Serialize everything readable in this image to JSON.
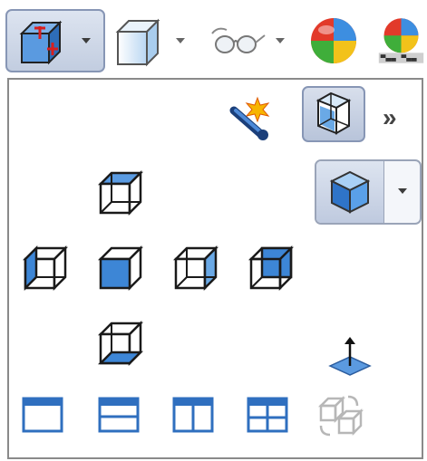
{
  "toolbar": {
    "buttons": [
      {
        "id": "view-orientation",
        "icon": "view-orientation-icon",
        "has_dropdown": true,
        "active": true
      },
      {
        "id": "display-style",
        "icon": "display-style-icon",
        "has_dropdown": true
      },
      {
        "id": "hide-show-items",
        "icon": "glasses-icon",
        "has_dropdown": true
      },
      {
        "id": "edit-appearance",
        "icon": "appearance-sphere-icon",
        "has_dropdown": false
      },
      {
        "id": "apply-scene",
        "icon": "scene-icon",
        "has_dropdown": false
      }
    ],
    "more_label": "»"
  },
  "panel": {
    "top_row": [
      {
        "id": "new-view",
        "icon": "new-view-wand-icon"
      },
      {
        "id": "view-selector",
        "icon": "view-selector-cube-icon",
        "active": true
      },
      {
        "id": "more",
        "icon": "chevron-double-right-icon"
      }
    ],
    "view_buttons": [
      {
        "id": "top",
        "icon": "top-view-icon"
      },
      {
        "id": "isometric",
        "icon": "isometric-view-icon"
      },
      {
        "id": "left",
        "icon": "left-view-icon"
      },
      {
        "id": "front",
        "icon": "front-view-icon"
      },
      {
        "id": "right",
        "icon": "right-view-icon"
      },
      {
        "id": "back",
        "icon": "back-view-icon"
      },
      {
        "id": "bottom",
        "icon": "bottom-view-icon"
      },
      {
        "id": "normal-to",
        "icon": "normal-to-icon"
      }
    ],
    "viewport_buttons": [
      {
        "id": "single-view",
        "icon": "single-viewport-icon"
      },
      {
        "id": "two-view-horizontal",
        "icon": "two-view-horizontal-icon"
      },
      {
        "id": "two-view-vertical",
        "icon": "two-view-vertical-icon"
      },
      {
        "id": "four-view",
        "icon": "four-viewport-icon"
      },
      {
        "id": "link-views",
        "icon": "link-views-icon",
        "disabled": true
      }
    ]
  },
  "colors": {
    "accent": "#3b78c4",
    "cube_blue": "#4a90d9",
    "border": "#8a8a8a",
    "active_bg": "#c7d1e3"
  }
}
